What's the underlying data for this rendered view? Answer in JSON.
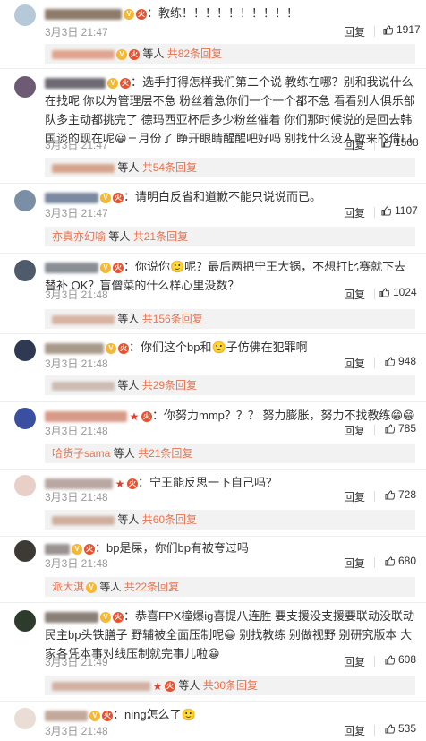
{
  "ui": {
    "reply": "回复",
    "people_suffix": "等人",
    "total_prefix": "共",
    "reply_suffix": "条回复"
  },
  "comments": [
    {
      "text": "：教练！！！！！！！！！！",
      "time": "3月3日 21:47",
      "likes": "1917",
      "sub_name": "",
      "sub_count": "共82条回复"
    },
    {
      "text": "：选手打得怎样我们第二个说 教练在哪？别和我说什么 在找呢 你以为管理层不急 粉丝着急你们一个一个都不急 看看别人俱乐部队多主动都挑完了 德玛西亚杯后多少粉丝催着 你们那时候说的是回去韩国谈的现在呢😀三月份了 睁开眼睛醒醒吧好吗 别找什么没人敢来的借口",
      "time": "3月3日 21:47",
      "likes": "1508",
      "sub_name": "",
      "sub_count": "共54条回复"
    },
    {
      "text": "：请明白反省和道歉不能只说说而已。",
      "time": "3月3日 21:47",
      "likes": "1107",
      "sub_name": "亦真亦幻喻",
      "sub_count": "共21条回复"
    },
    {
      "text": "：你说你🙂呢？最后两把宁王大锅，不想打比赛就下去替补 OK？盲僧菜的什么样心里没数？",
      "time": "3月3日 21:48",
      "likes": "1024",
      "sub_name": "",
      "sub_count": "共156条回复"
    },
    {
      "text": "：你们这个bp和🙂子仿佛在犯罪啊",
      "time": "3月3日 21:48",
      "likes": "948",
      "sub_name": "",
      "sub_count": "共29条回复"
    },
    {
      "text": "：你努力mmp？？？ 努力膨胀，努力不找教练😁😁",
      "time": "3月3日 21:48",
      "likes": "785",
      "sub_name": "哈货子sama",
      "sub_count": "共21条回复"
    },
    {
      "text": "：宁王能反思一下自己吗？",
      "time": "3月3日 21:48",
      "likes": "728",
      "sub_name": "",
      "sub_count": "共60条回复"
    },
    {
      "text": "：bp是屎，你们bp有被夸过吗",
      "time": "3月3日 21:48",
      "likes": "680",
      "sub_name": "派大淇",
      "sub_count": "共22条回复"
    },
    {
      "text": "：恭喜FPX橦爆ig喜提八连胜 要支援没支援要联动没联动 民主bp头铁膳子 野辅被全面压制呢😀 别找教练 别做视野 别研究版本 大家各凭本事对线压制就完事儿啦😀",
      "time": "3月3日 21:49",
      "likes": "608",
      "sub_name": "",
      "sub_count": "共30条回复"
    },
    {
      "text": "：ning怎么了🙂",
      "time": "3月3日 21:48",
      "likes": "535",
      "sub_name": "",
      "sub_count": ""
    }
  ]
}
